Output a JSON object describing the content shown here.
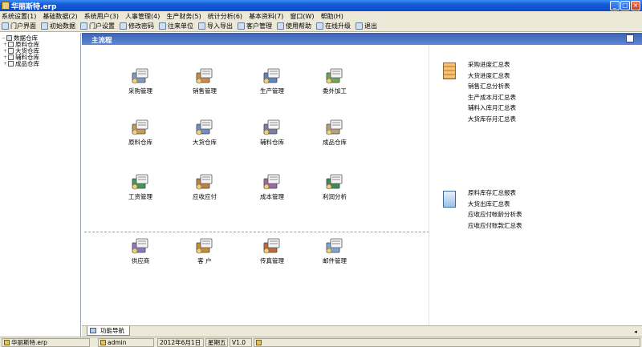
{
  "window": {
    "title": "华丽斯特.erp"
  },
  "window_buttons": [
    "_",
    "□",
    "×"
  ],
  "menu": [
    "系统设置(1)",
    "基础数据(2)",
    "系统用户(3)",
    "人事管理(4)",
    "生产财务(5)",
    "统计分析(6)",
    "基本资料(7)",
    "窗口(W)",
    "帮助(H)"
  ],
  "toolbar": [
    {
      "label": "门户界面",
      "icon": "home-icon"
    },
    {
      "label": "初始数据",
      "icon": "data-icon"
    },
    {
      "label": "门户设置",
      "icon": "portal-settings-icon"
    },
    {
      "label": "修改密码",
      "icon": "password-icon"
    },
    {
      "label": "往来单位",
      "icon": "units-icon"
    },
    {
      "label": "导入导出",
      "icon": "import-export-icon"
    },
    {
      "label": "客户管理",
      "icon": "customer-icon"
    },
    {
      "label": "使用帮助",
      "icon": "help-icon"
    },
    {
      "label": "在线升级",
      "icon": "update-icon"
    },
    {
      "label": "退出",
      "icon": "exit-icon"
    }
  ],
  "tree": {
    "root": "数据仓库",
    "items": [
      "原料仓库",
      "大货仓库",
      "辅料仓库",
      "成品仓库"
    ]
  },
  "main": {
    "title": "主流程"
  },
  "modules": [
    {
      "label": "采购管理",
      "icon": "purchase-icon",
      "color": "#7d9bc4"
    },
    {
      "label": "销售管理",
      "icon": "sales-icon",
      "color": "#c98a4a"
    },
    {
      "label": "生产管理",
      "icon": "production-icon",
      "color": "#5a86c6"
    },
    {
      "label": "委外加工",
      "icon": "outsource-icon",
      "color": "#6fa85a"
    },
    {
      "label": "原料仓库",
      "icon": "warehouse-icon",
      "color": "#c99a5a"
    },
    {
      "label": "大货仓库",
      "icon": "warehouse-icon",
      "color": "#6b8fc8"
    },
    {
      "label": "辅料仓库",
      "icon": "warehouse-icon",
      "color": "#7b7fa8"
    },
    {
      "label": "成品仓库",
      "icon": "warehouse-icon",
      "color": "#b8a07a"
    },
    {
      "label": "工资管理",
      "icon": "salary-icon",
      "color": "#3f9a58"
    },
    {
      "label": "应收应付",
      "icon": "finance-icon",
      "color": "#c08040"
    },
    {
      "label": "成本管理",
      "icon": "cost-icon",
      "color": "#9a6aa8"
    },
    {
      "label": "利润分析",
      "icon": "profit-icon",
      "color": "#3f8a5a"
    },
    {
      "label": "供应商",
      "icon": "supplier-icon",
      "color": "#8a7ac0"
    },
    {
      "label": "客 户",
      "icon": "client-icon",
      "color": "#c8902a"
    },
    {
      "label": "传真管理",
      "icon": "fax-icon",
      "color": "#c06a3a"
    },
    {
      "label": "邮件管理",
      "icon": "mail-icon",
      "color": "#7aa6d8"
    }
  ],
  "side_reports_1": [
    "采购进度汇总表",
    "大货进度汇总表",
    "销售汇总分析表",
    "生产成本月汇总表",
    "辅料入库月汇总表",
    "大货库存月汇总表"
  ],
  "side_reports_2": [
    "原料库存汇总报表",
    "大货出库汇总表",
    "应收应付帐龄分析表",
    "应收应付账款汇总表"
  ],
  "tab": {
    "label": "功能导航"
  },
  "status": {
    "app": "华丽斯特.erp",
    "user": "admin",
    "date": "2012年6月1日",
    "day": "星期五",
    "ver": "V1.0"
  }
}
